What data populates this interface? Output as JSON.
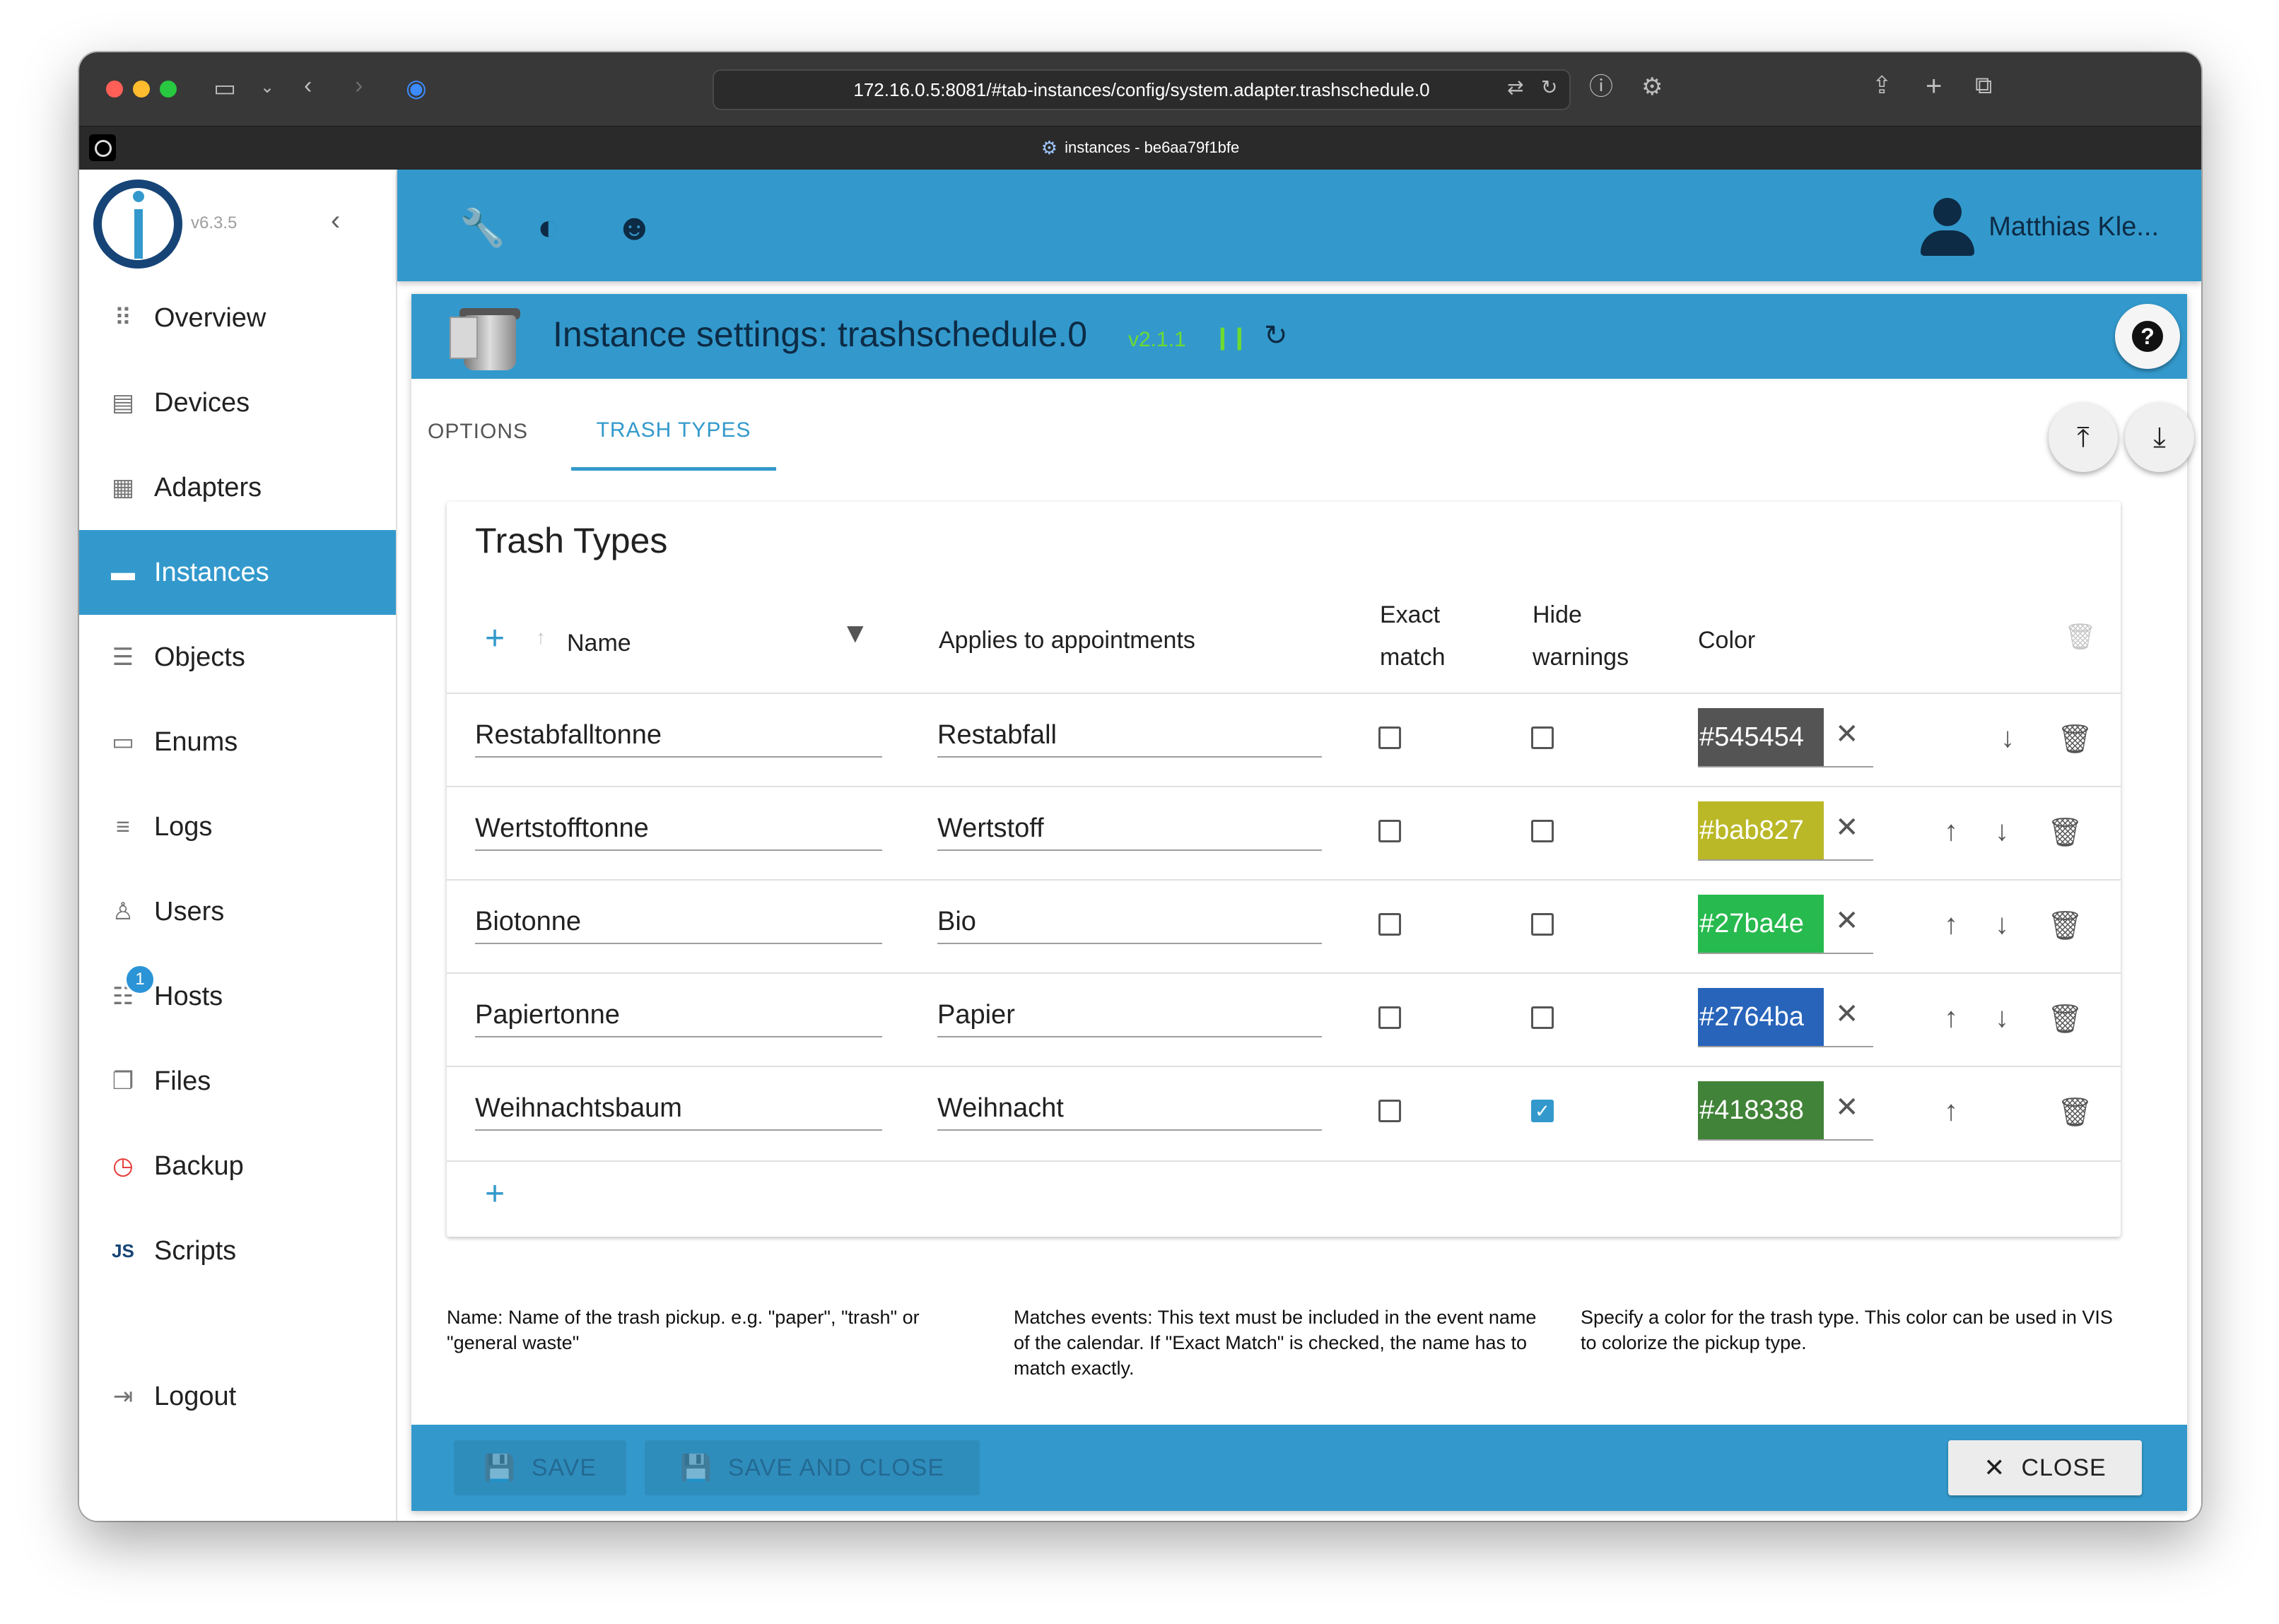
{
  "browser": {
    "url": "172.16.0.5:8081/#tab-instances/config/system.adapter.trashschedule.0",
    "tab_title": "instances - be6aa79f1bfe"
  },
  "sidebar": {
    "version": "v6.3.5",
    "items": [
      {
        "label": "Overview",
        "icon": "grid-icon"
      },
      {
        "label": "Devices",
        "icon": "devices-icon"
      },
      {
        "label": "Adapters",
        "icon": "store-icon"
      },
      {
        "label": "Instances",
        "icon": "instances-icon",
        "active": true
      },
      {
        "label": "Objects",
        "icon": "list-icon"
      },
      {
        "label": "Enums",
        "icon": "enums-icon"
      },
      {
        "label": "Logs",
        "icon": "logs-icon"
      },
      {
        "label": "Users",
        "icon": "user-icon"
      },
      {
        "label": "Hosts",
        "icon": "hosts-icon",
        "badge": "1"
      },
      {
        "label": "Files",
        "icon": "files-icon"
      },
      {
        "label": "Backup",
        "icon": "backup-icon"
      },
      {
        "label": "Scripts",
        "icon": "js-icon"
      }
    ],
    "logout": "Logout"
  },
  "appbar": {
    "user_name": "Matthias Kle..."
  },
  "dialog": {
    "title": "Instance settings: trashschedule.0",
    "version": "v2.1.1",
    "tabs": [
      "OPTIONS",
      "TRASH TYPES"
    ],
    "active_tab": "TRASH TYPES",
    "card_title": "Trash Types",
    "columns": {
      "name": "Name",
      "applies": "Applies to appointments",
      "exact_1": "Exact",
      "exact_2": "match",
      "hide_1": "Hide",
      "hide_2": "warnings",
      "color": "Color"
    },
    "rows": [
      {
        "name": "Restabfalltonne",
        "applies": "Restabfall",
        "exact": false,
        "hide": false,
        "color": "#545454",
        "swatch_text": "#545454"
      },
      {
        "name": "Wertstofftonne",
        "applies": "Wertstoff",
        "exact": false,
        "hide": false,
        "color": "#bab827",
        "swatch_text": "#bab827"
      },
      {
        "name": "Biotonne",
        "applies": "Bio",
        "exact": false,
        "hide": false,
        "color": "#27ba4e",
        "swatch_text": "#27ba4e"
      },
      {
        "name": "Papiertonne",
        "applies": "Papier",
        "exact": false,
        "hide": false,
        "color": "#2764ba",
        "swatch_text": "#2764ba"
      },
      {
        "name": "Weihnachtsbaum",
        "applies": "Weihnacht",
        "exact": false,
        "hide": true,
        "color": "#418338",
        "swatch_text": "#418338"
      }
    ],
    "help": {
      "name": "Name: Name of the trash pickup. e.g. \"paper\", \"trash\" or \"general waste\"",
      "match": "Matches events: This text must be included in the event name of the calendar. If \"Exact Match\" is checked, the name has to match exactly.",
      "color": "Specify a color for the trash type. This color can be used in VIS to colorize the pickup type."
    },
    "buttons": {
      "save": "SAVE",
      "save_close": "SAVE AND CLOSE",
      "close": "CLOSE"
    }
  },
  "colors": {
    "primary": "#3399cc",
    "primary_dark": "#164477",
    "header_text": "#0d2b45",
    "version_green": "#6ddb2e"
  }
}
